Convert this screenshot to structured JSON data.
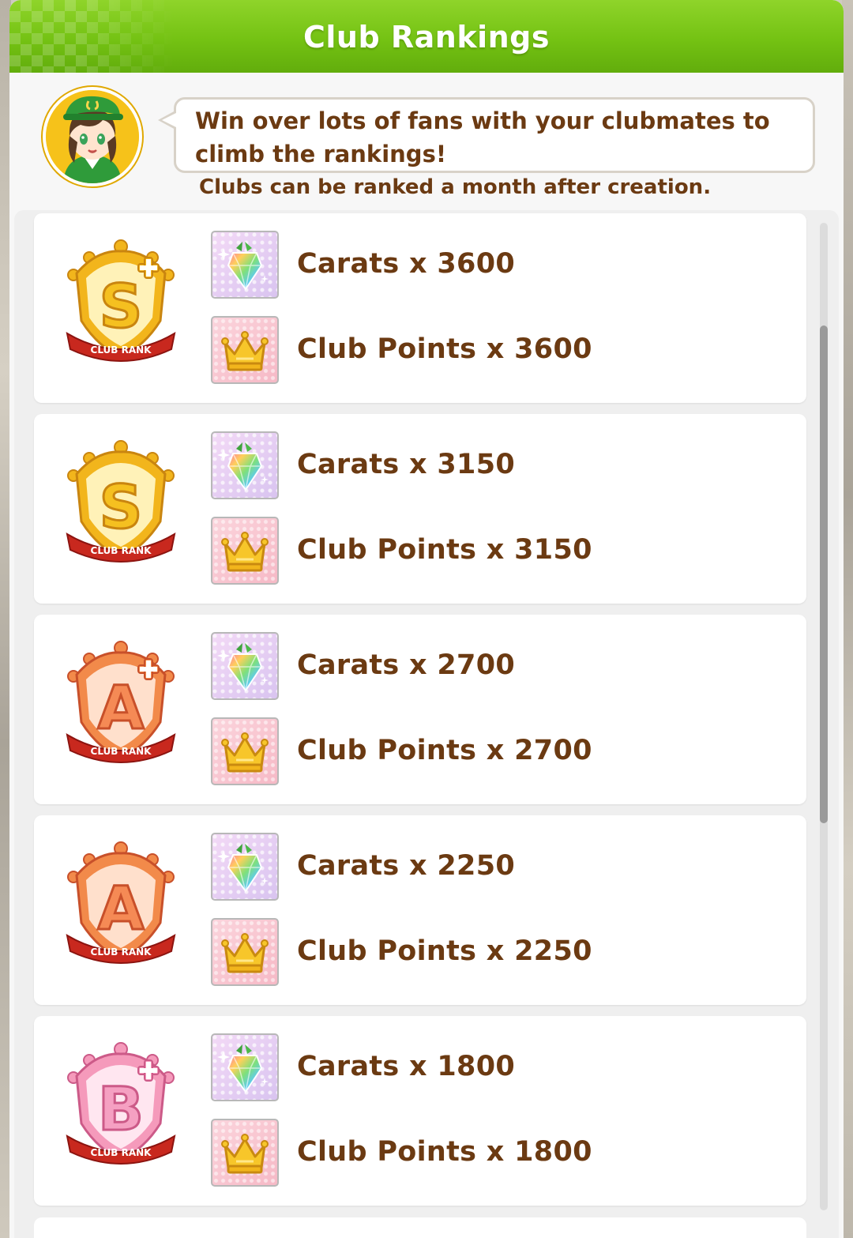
{
  "header": {
    "title": "Club Rankings"
  },
  "speech": {
    "message": "Win over lots of fans with your clubmates to climb the rankings!",
    "notice": "Clubs can be ranked a month after creation."
  },
  "badge_text": "CLUB RANK",
  "colors": {
    "header_green": "#74c213",
    "text_brown": "#6b3a12",
    "gold": "#f2b51c",
    "orange": "#f07a3a",
    "pink": "#f28cb0"
  },
  "ranks": [
    {
      "rank": "S+",
      "letter": "S",
      "plus": true,
      "color_theme": "gold",
      "carats_label": "Carats x 3600",
      "points_label": "Club Points x 3600"
    },
    {
      "rank": "S",
      "letter": "S",
      "plus": false,
      "color_theme": "gold",
      "carats_label": "Carats x 3150",
      "points_label": "Club Points x 3150"
    },
    {
      "rank": "A+",
      "letter": "A",
      "plus": true,
      "color_theme": "orange",
      "carats_label": "Carats x 2700",
      "points_label": "Club Points x 2700"
    },
    {
      "rank": "A",
      "letter": "A",
      "plus": false,
      "color_theme": "orange",
      "carats_label": "Carats x 2250",
      "points_label": "Club Points x 2250"
    },
    {
      "rank": "B+",
      "letter": "B",
      "plus": true,
      "color_theme": "pink",
      "carats_label": "Carats x 1800",
      "points_label": "Club Points x 1800"
    }
  ],
  "icons": {
    "carat": "carat-crystal-icon",
    "points": "club-points-crown-icon",
    "badge": "club-rank-badge-icon",
    "avatar": "character-avatar"
  }
}
